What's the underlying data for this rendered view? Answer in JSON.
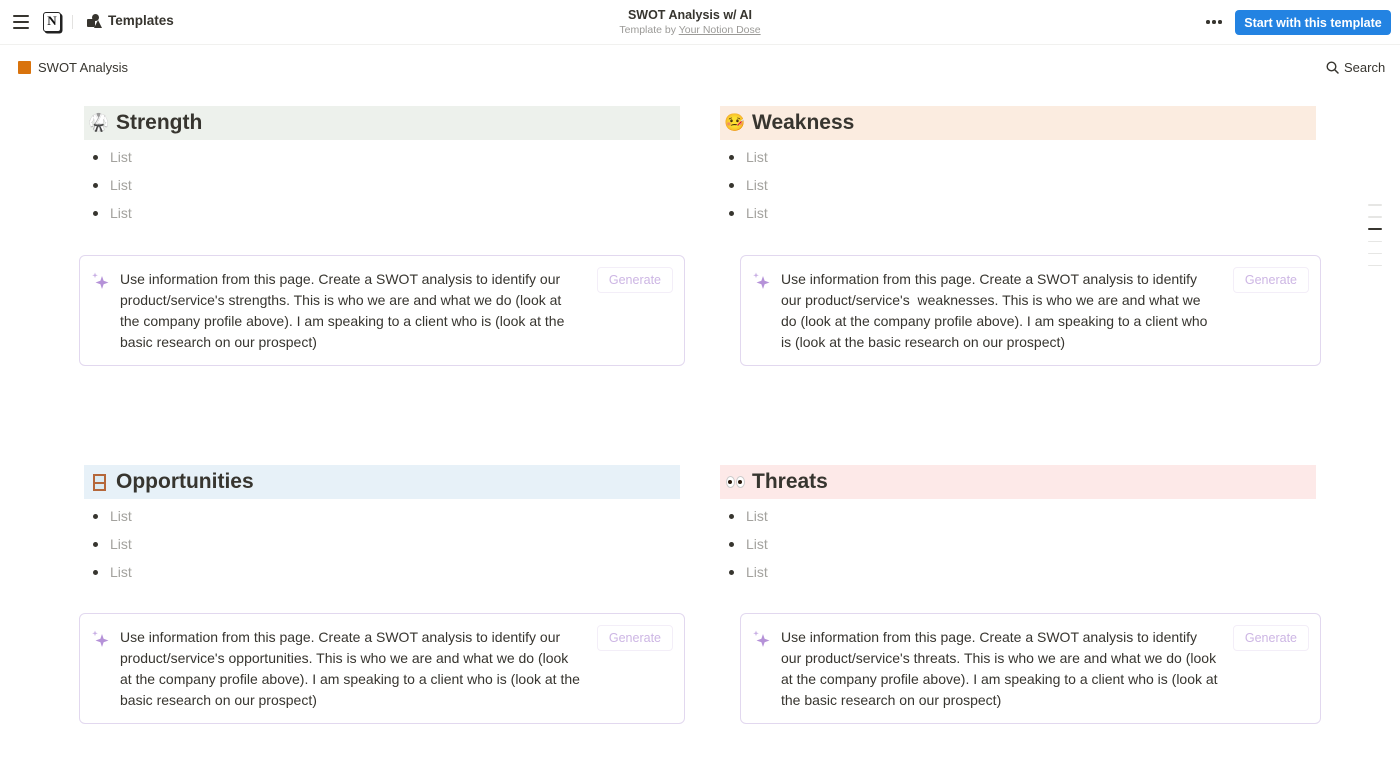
{
  "topbar": {
    "templates_label": "Templates",
    "title": "SWOT Analysis w/ AI",
    "subtitle_prefix": "Template by ",
    "author": "Your Notion Dose",
    "start_button": "Start with this template"
  },
  "breadcrumb": {
    "page_name": "SWOT Analysis",
    "page_icon_color": "#d9730d"
  },
  "search_label": "Search",
  "sections": [
    {
      "title": "Strength",
      "emoji": "🥋",
      "header_bg": "#edf1ec",
      "items": [
        "List",
        "List",
        "List"
      ],
      "prompt_lines": [
        "Use information from this page. Create a SWOT analysis to identify our",
        "product/service's strengths. This is who we are and what we do (look at",
        "the company profile above). I am speaking to a client who is (look at the",
        "basic research on our prospect)"
      ],
      "generate_label": "Generate"
    },
    {
      "title": "Weakness",
      "emoji": "🤒",
      "header_bg": "#fbece0",
      "items": [
        "List",
        "List",
        "List"
      ],
      "prompt_lines": [
        "Use information from this page. Create a SWOT analysis to identify",
        "our product/service's  weaknesses. This is who we are and what we",
        "do (look at the company profile above). I am speaking to a client who",
        "is (look at the basic research on our prospect)"
      ],
      "generate_label": "Generate"
    },
    {
      "title": "Opportunities",
      "emoji": "🪟",
      "header_bg": "#e7f1f8",
      "items": [
        "List",
        "List",
        "List"
      ],
      "prompt_lines": [
        "Use information from this page. Create a SWOT analysis to identify our",
        "product/service's opportunities. This is who we are and what we do (look",
        "at the company profile above). I am speaking to a client who is (look at the",
        "basic research on our prospect)"
      ],
      "generate_label": "Generate"
    },
    {
      "title": "Threats",
      "emoji": "👀",
      "header_bg": "#fde9e8",
      "items": [
        "List",
        "List",
        "List"
      ],
      "prompt_lines": [
        "Use information from this page. Create a SWOT analysis to identify",
        "our product/service's threats. This is who we are and what we do (look",
        "at the company profile above). I am speaking to a client who is (look at",
        "the basic research on our prospect)"
      ],
      "generate_label": "Generate"
    }
  ],
  "toc": {
    "entries": 6,
    "active_index": 2
  },
  "colors": {
    "accent": "#2383e2",
    "ai_border": "#e2d8ef",
    "generate_text": "#cdb6e4"
  }
}
